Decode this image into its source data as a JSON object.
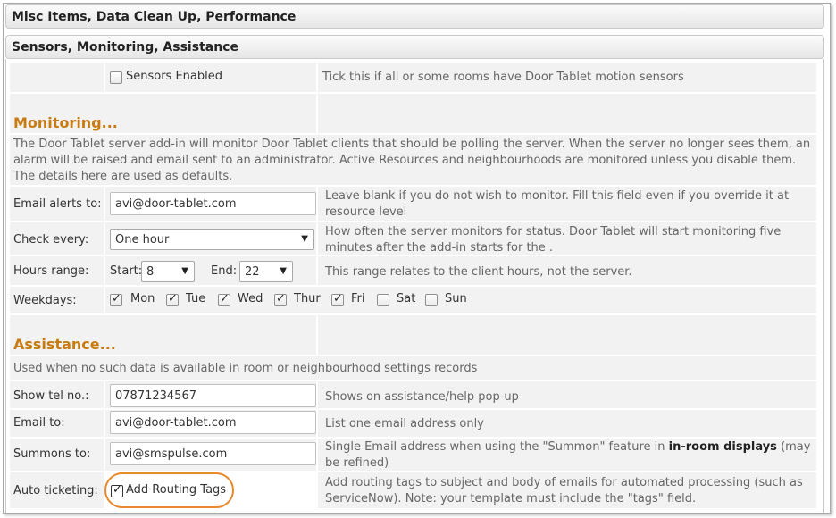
{
  "sections": {
    "misc_title": "Misc Items, Data Clean Up, Performance",
    "sensors_title": "Sensors, Monitoring, Assistance"
  },
  "sensors": {
    "checkbox_label": "Sensors Enabled",
    "checked": false,
    "help": "Tick this if all or some rooms have Door Tablet motion sensors"
  },
  "monitoring": {
    "heading": "Monitoring...",
    "description": "The Door Tablet server add-in will monitor Door Tablet clients that should be polling the server. When the server no longer sees them, an alarm will be raised and email sent to an administrator. Active Resources and neighbourhoods are monitored unless you disable them. The details here are used as defaults.",
    "email_label": "Email alerts to:",
    "email_value": "avi@door-tablet.com",
    "email_help": "Leave blank if you do not wish to monitor. Fill this field even if you override it at resource level",
    "check_label": "Check every:",
    "check_value": "One hour",
    "check_help": "How often the server monitors for status. Door Tablet will start monitoring five minutes after the add-in starts for the .",
    "hours_label": "Hours range:",
    "start_label": "Start:",
    "start_value": "8",
    "end_label": "End:",
    "end_value": "22",
    "hours_help": "This range relates to the client hours, not the server.",
    "weekdays_label": "Weekdays:",
    "weekdays": [
      {
        "label": "Mon",
        "checked": true
      },
      {
        "label": "Tue",
        "checked": true
      },
      {
        "label": "Wed",
        "checked": true
      },
      {
        "label": "Thur",
        "checked": true
      },
      {
        "label": "Fri",
        "checked": true
      },
      {
        "label": "Sat",
        "checked": false
      },
      {
        "label": "Sun",
        "checked": false
      }
    ]
  },
  "assistance": {
    "heading": "Assistance...",
    "description": "Used when no such data is available in room or neighbourhood settings records",
    "tel_label": "Show tel no.:",
    "tel_value": "07871234567",
    "tel_help": "Shows on assistance/help pop-up",
    "email_label": "Email to:",
    "email_value": "avi@door-tablet.com",
    "email_help": "List one email address only",
    "summons_label": "Summons to:",
    "summons_value": "avi@smspulse.com",
    "summons_help_1": "Single Email address when using the \"Summon\" feature in ",
    "summons_help_bold": "in-room displays",
    "summons_help_2": " (may be refined)",
    "ticket_label": "Auto ticketing:",
    "ticket_checkbox_label": "Add Routing Tags",
    "ticket_checked": true,
    "ticket_help": "Add routing tags to subject and body of emails for automated processing (such as ServiceNow). Note: your template must include the \"tags\" field."
  },
  "colors": {
    "heading_orange": "#c77b10",
    "highlight_ring": "#e8892b"
  }
}
